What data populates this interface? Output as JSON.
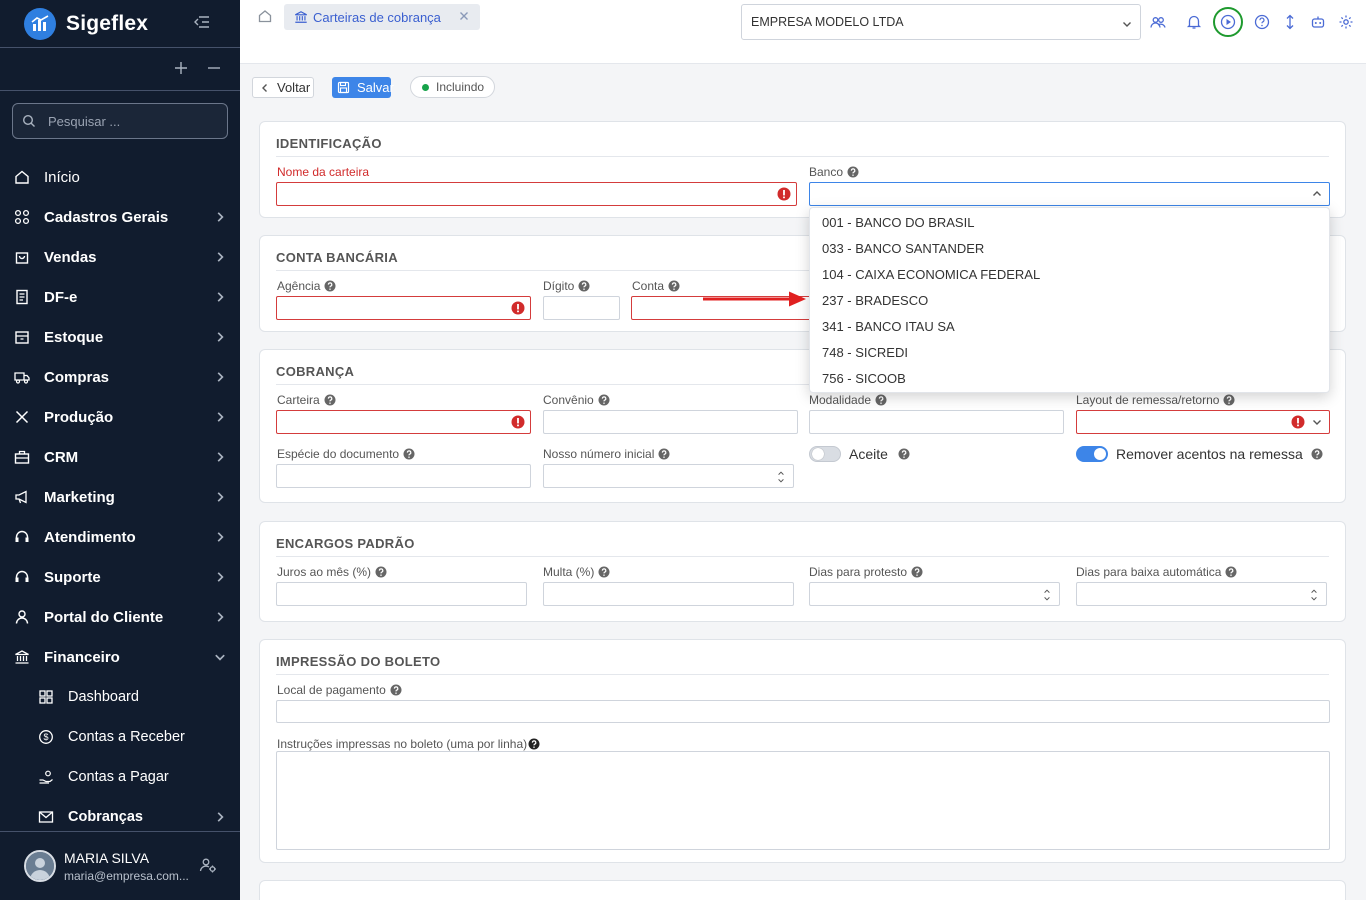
{
  "app": {
    "name": "Sigeflex"
  },
  "sidebar": {
    "search_placeholder": "Pesquisar ...",
    "items": [
      {
        "label": "Início",
        "icon": "home-icon"
      },
      {
        "label": "Cadastros Gerais",
        "icon": "grid-icon"
      },
      {
        "label": "Vendas",
        "icon": "shopping-bag-icon"
      },
      {
        "label": "DF-e",
        "icon": "document-icon"
      },
      {
        "label": "Estoque",
        "icon": "box-icon"
      },
      {
        "label": "Compras",
        "icon": "truck-icon"
      },
      {
        "label": "Produção",
        "icon": "tools-icon"
      },
      {
        "label": "CRM",
        "icon": "briefcase-icon"
      },
      {
        "label": "Marketing",
        "icon": "megaphone-icon"
      },
      {
        "label": "Atendimento",
        "icon": "headset-icon"
      },
      {
        "label": "Suporte",
        "icon": "headset-icon"
      },
      {
        "label": "Portal do Cliente",
        "icon": "user-icon"
      },
      {
        "label": "Financeiro",
        "icon": "bank-icon"
      }
    ],
    "sub_items": [
      {
        "label": "Dashboard",
        "icon": "dashboard-icon"
      },
      {
        "label": "Contas a Receber",
        "icon": "dollar-circle-icon"
      },
      {
        "label": "Contas a Pagar",
        "icon": "hand-coins-icon"
      },
      {
        "label": "Cobranças",
        "icon": "mail-icon"
      }
    ],
    "user": {
      "name": "MARIA SILVA",
      "email": "maria@empresa.com..."
    }
  },
  "topbar": {
    "tab_label": "Carteiras de cobrança",
    "company": "EMPRESA MODELO LTDA"
  },
  "toolbar": {
    "back_label": "Voltar",
    "save_label": "Salvar",
    "status_label": "Incluindo",
    "status_color": "#17a34a"
  },
  "sections": {
    "identificacao": {
      "title": "IDENTIFICAÇÃO",
      "nome_label": "Nome da carteira",
      "banco_label": "Banco"
    },
    "conta": {
      "title": "CONTA BANCÁRIA",
      "agencia_label": "Agência",
      "digito_label": "Dígito",
      "conta_label": "Conta"
    },
    "cobranca": {
      "title": "COBRANÇA",
      "carteira_label": "Carteira",
      "convenio_label": "Convênio",
      "modalidade_label": "Modalidade",
      "layout_label": "Layout de remessa/retorno",
      "especie_label": "Espécie do documento",
      "nosso_numero_label": "Nosso número inicial",
      "aceite_label": "Aceite",
      "aceite_on": false,
      "remover_label": "Remover acentos na remessa",
      "remover_on": true
    },
    "encargos": {
      "title": "ENCARGOS PADRÃO",
      "juros_label": "Juros ao mês (%)",
      "multa_label": "Multa (%)",
      "protesto_label": "Dias para protesto",
      "baixa_label": "Dias para baixa automática"
    },
    "impressao": {
      "title": "IMPRESSÃO DO BOLETO",
      "local_label": "Local de pagamento",
      "instrucoes_label": "Instruções impressas no boleto (uma por linha)"
    }
  },
  "banco_options": [
    "001 - BANCO DO BRASIL",
    "033 - BANCO SANTANDER",
    "104 - CAIXA ECONOMICA FEDERAL",
    "237 - BRADESCO",
    "341 - BANCO ITAU SA",
    "748 - SICREDI",
    "756 - SICOOB"
  ],
  "colors": {
    "accent": "#3d85e8",
    "error": "#d12b2b",
    "sidebar_bg": "#111c2e",
    "annotation_arrow": "#e02020",
    "highlight_ring": "#1e9a2e"
  }
}
